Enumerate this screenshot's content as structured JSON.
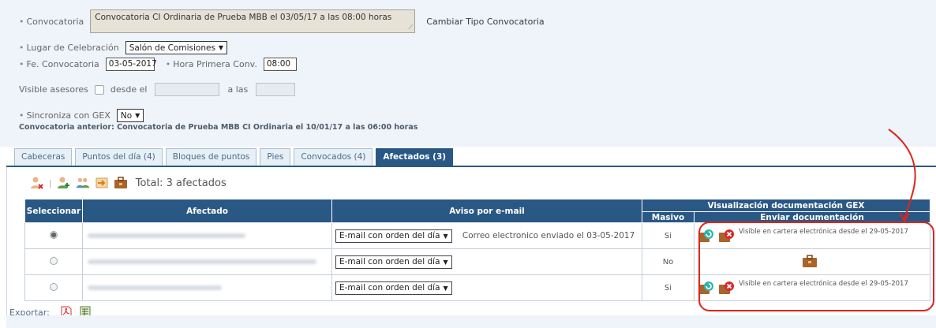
{
  "form": {
    "convocatoria_label": "Convocatoria",
    "convocatoria_value": "Convocatoria CI Ordinaria de Prueba MBB el 03/05/17 a las 08:00 horas",
    "cambiar_link": "Cambiar Tipo Convocatoria",
    "lugar_label": "Lugar de Celebración",
    "lugar_value": "Salón de Comisiones",
    "fecha_label": "Fe. Convocatoria",
    "fecha_value": "03-05-2017",
    "hora_label": "Hora Primera Conv.",
    "hora_value": "08:00",
    "visible_label": "Visible asesores",
    "desde_label": "desde el",
    "alas_label": "a las",
    "sincroniza_label": "Sincroniza con GEX",
    "sincroniza_value": "No",
    "anterior_note": "Convocatoria anterior: Convocatoria de Prueba MBB CI Ordinaria el 10/01/17 a las 06:00 horas"
  },
  "tabs": [
    {
      "label": "Cabeceras"
    },
    {
      "label": "Puntos del día (4)"
    },
    {
      "label": "Bloques de puntos"
    },
    {
      "label": "Pies"
    },
    {
      "label": "Convocados (4)"
    },
    {
      "label": "Afectados (3)"
    }
  ],
  "toolbar": {
    "total": "Total: 3 afectados"
  },
  "table": {
    "headers": {
      "seleccionar": "Seleccionar",
      "afectado": "Afectado",
      "aviso": "Aviso por e-mail",
      "gex": "Visualización documentación GEX",
      "masivo": "Masivo",
      "enviar": "Enviar documentación"
    },
    "rows": [
      {
        "aviso": "E-mail con orden del día",
        "estado": "Correo electronico enviado el 03-05-2017",
        "masivo": "Si",
        "visible": "Visible en cartera electrónica desde el 29-05-2017"
      },
      {
        "aviso": "E-mail con orden del día",
        "estado": "",
        "masivo": "No",
        "visible": ""
      },
      {
        "aviso": "E-mail con orden del día",
        "estado": "",
        "masivo": "Si",
        "visible": "Visible en cartera electrónica desde el 29-05-2017"
      }
    ]
  },
  "export": {
    "label": "Exportar:"
  },
  "colors": {
    "header_blue": "#2a5885",
    "annotation_red": "#e0241c"
  },
  "icons": [
    "remove-user-icon",
    "add-user-icon",
    "users-icon",
    "import-icon",
    "briefcase-icon",
    "pdf-icon",
    "excel-icon",
    "refresh-doc-icon",
    "delete-doc-icon"
  ]
}
